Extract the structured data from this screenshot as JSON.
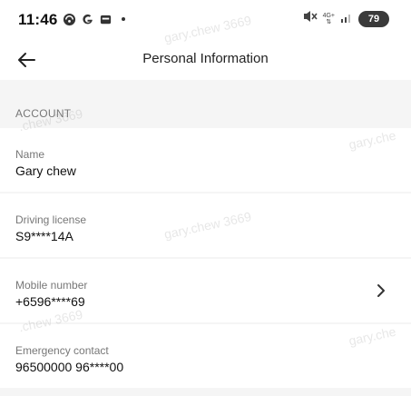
{
  "status_bar": {
    "time": "11:46",
    "battery": "79",
    "network": "4G+",
    "icons": [
      "vpn-icon",
      "google-icon",
      "wallet-icon",
      "mute-icon",
      "signal-icon"
    ]
  },
  "header": {
    "title": "Personal Information"
  },
  "section": {
    "title": "ACCOUNT"
  },
  "fields": [
    {
      "label": "Name",
      "value": "Gary chew"
    },
    {
      "label": "Driving license",
      "value": "S9****14A"
    },
    {
      "label": "Mobile number",
      "value": "+6596****69"
    },
    {
      "label": "Emergency contact",
      "value": "96500000 96****00"
    }
  ],
  "watermark": {
    "text": "gary.chew 3669",
    "text_short": "gary.che",
    "text_left": ".chew 3669"
  },
  "colors": {
    "background": "#f5f5f5",
    "surface": "#ffffff",
    "label": "#777777",
    "battery_bg": "#3a3a3a"
  }
}
